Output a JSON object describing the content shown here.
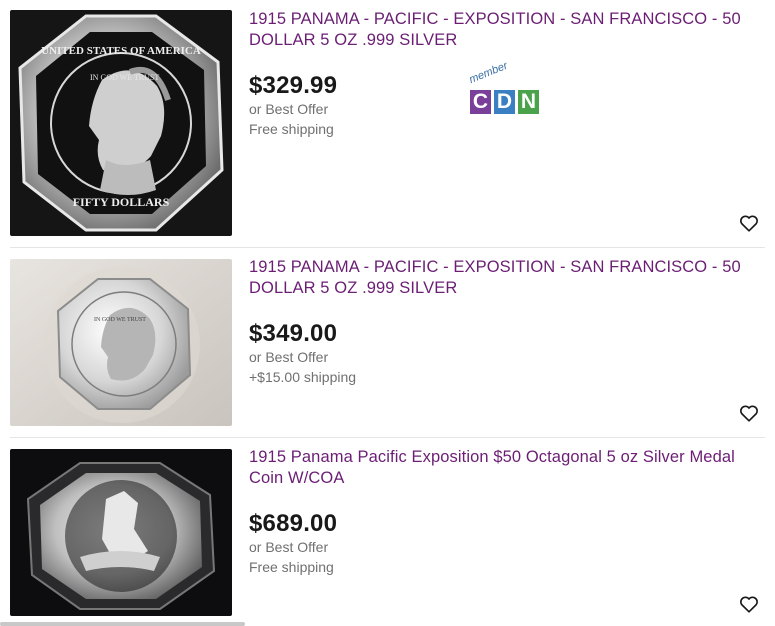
{
  "listings": [
    {
      "title": "1915 PANAMA - PACIFIC - EXPOSITION - SAN FRANCISCO - 50 DOLLAR 5 OZ .999 SILVER",
      "price": "$329.99",
      "offer": "or Best Offer",
      "shipping": "Free shipping",
      "badge": {
        "top": "member",
        "letters": [
          "C",
          "D",
          "N"
        ],
        "colors": [
          "#7a3f98",
          "#3a7fc1",
          "#4aa34a"
        ]
      }
    },
    {
      "title": "1915 PANAMA - PACIFIC - EXPOSITION - SAN FRANCISCO - 50 DOLLAR 5 OZ .999 SILVER",
      "price": "$349.00",
      "offer": "or Best Offer",
      "shipping": "+$15.00 shipping"
    },
    {
      "title": "1915 Panama Pacific Exposition $50 Octagonal 5 oz Silver Medal Coin W/COA",
      "price": "$689.00",
      "offer": "or Best Offer",
      "shipping": "Free shipping"
    }
  ],
  "coin_text": {
    "top": "UNITED STATES OF AMERICA",
    "motto": "IN GOD WE TRUST",
    "bottom": "FIFTY DOLLARS"
  },
  "icons": {
    "watchlist": "heart-outline-icon"
  },
  "colors": {
    "title": "#6b1e74",
    "price": "#191919",
    "meta": "#707070"
  }
}
